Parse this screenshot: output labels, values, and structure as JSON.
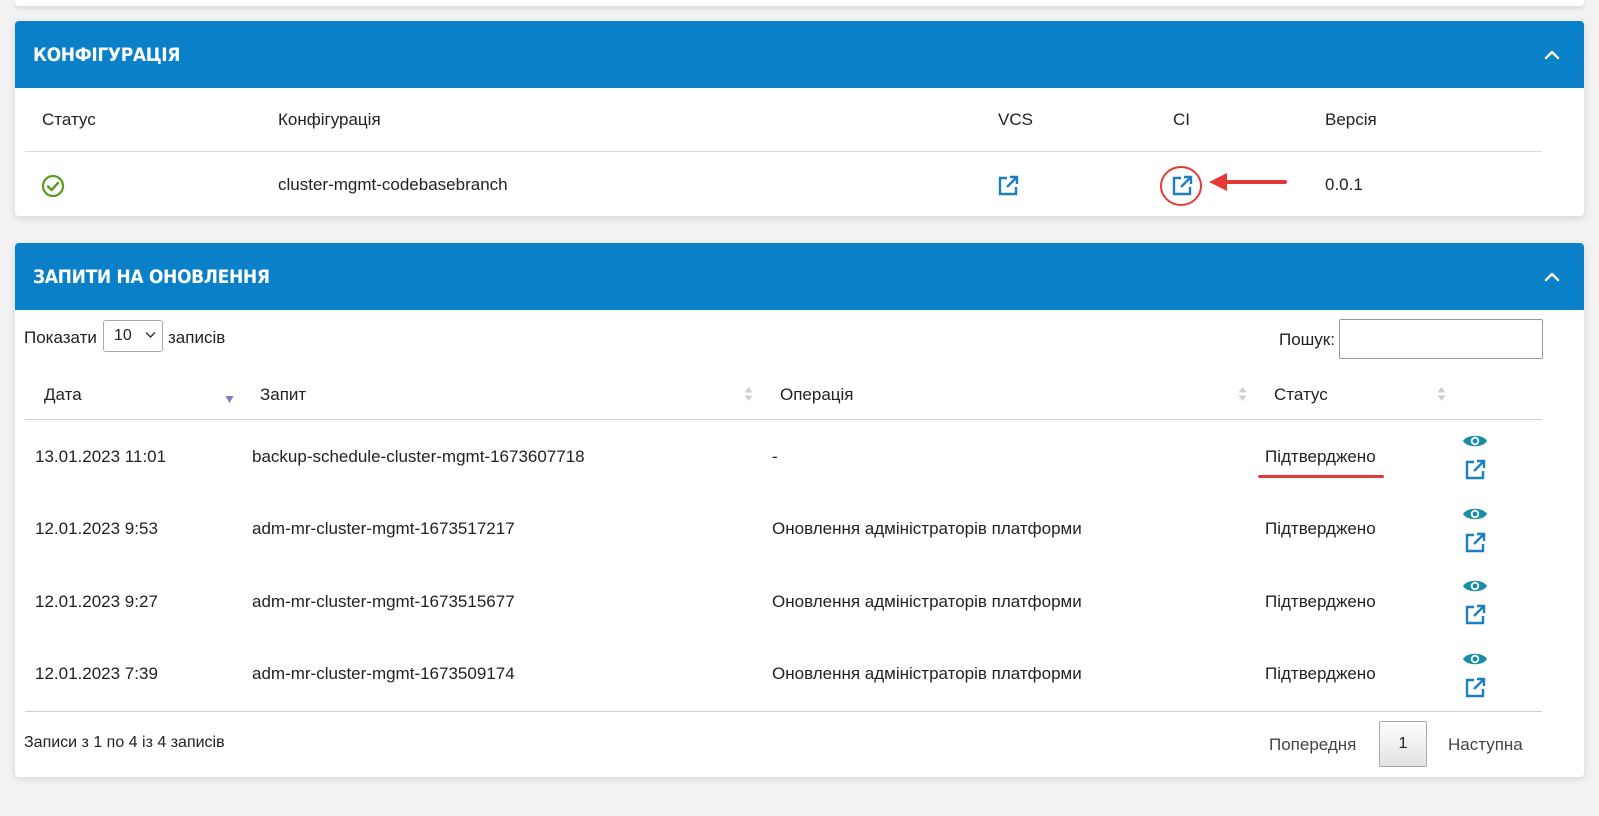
{
  "config_section": {
    "title": "КОНФІГУРАЦІЯ",
    "columns": {
      "status": "Статус",
      "configuration": "Конфігурація",
      "vcs": "VCS",
      "ci": "CI",
      "version": "Версія"
    },
    "row": {
      "status_icon": "check-circle-icon",
      "configuration": "cluster-mgmt-codebasebranch",
      "version": "0.0.1"
    }
  },
  "requests_section": {
    "title": "ЗАПИТИ НА ОНОВЛЕННЯ",
    "length_label_before": "Показати",
    "length_value": "10",
    "length_label_after": "записів",
    "search_label": "Пошук:",
    "columns": {
      "date": "Дата",
      "request": "Запит",
      "operation": "Операція",
      "status": "Статус"
    },
    "rows": [
      {
        "date": "13.01.2023 11:01",
        "request": "backup-schedule-cluster-mgmt-1673607718",
        "operation": "-",
        "status": "Підтверджено"
      },
      {
        "date": "12.01.2023 9:53",
        "request": "adm-mr-cluster-mgmt-1673517217",
        "operation": "Оновлення адміністраторів платформи",
        "status": "Підтверджено"
      },
      {
        "date": "12.01.2023 9:27",
        "request": "adm-mr-cluster-mgmt-1673515677",
        "operation": "Оновлення адміністраторів платформи",
        "status": "Підтверджено"
      },
      {
        "date": "12.01.2023 7:39",
        "request": "adm-mr-cluster-mgmt-1673509174",
        "operation": "Оновлення адміністраторів платформи",
        "status": "Підтверджено"
      }
    ],
    "info": "Записи з 1 по 4 із 4 записів",
    "pagination": {
      "previous": "Попередня",
      "current": "1",
      "next": "Наступна"
    }
  },
  "colors": {
    "header_blue": "#0980c8",
    "link_blue": "#1b7fc4",
    "eye_teal": "#1a8da6",
    "success_green": "#5a9a1e",
    "annotation_red": "#e53935"
  }
}
